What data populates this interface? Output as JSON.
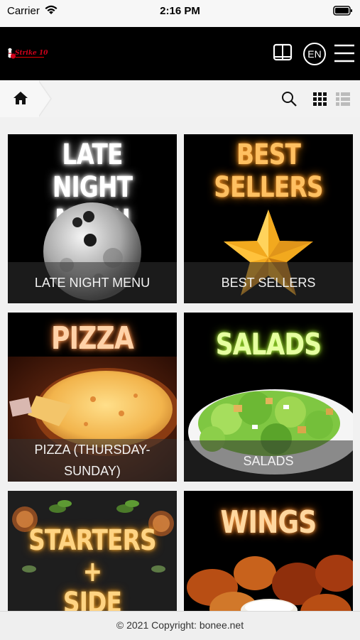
{
  "status_bar": {
    "carrier": "Carrier",
    "time": "2:16 PM"
  },
  "header": {
    "logo_text": "Strike 10",
    "language": "EN"
  },
  "toolbar": {
    "home": "home-icon",
    "search": "search-icon",
    "grid": "grid-view-icon",
    "list": "list-view-icon"
  },
  "categories": [
    {
      "title_line1": "LATE NIGHT",
      "title_line2": "MENU",
      "caption": "LATE NIGHT MENU"
    },
    {
      "title_line1": "BEST",
      "title_line2": "SELLERS",
      "caption": "BEST SELLERS"
    },
    {
      "title_line1": "PIZZA",
      "caption_line1": "PIZZA (THURSDAY-",
      "caption_line2": "SUNDAY)"
    },
    {
      "title_line1": "SALADS",
      "caption": "SALADS"
    },
    {
      "title_line1": "STARTERS",
      "title_line2": "+",
      "title_line3": "SIDE DISHES"
    },
    {
      "title_line1": "WINGS"
    }
  ],
  "footer": {
    "copyright": "© 2021 Copyright: bonee.net"
  },
  "colors": {
    "header_bg": "#000000",
    "card_bg": "#000000",
    "late_night_glow": "#ffffff",
    "best_sellers": "#ffc061",
    "pizza": "#ffd2a8",
    "salads": "#e6ffa0",
    "starters": "#ffd483",
    "wings": "#ffd79f"
  }
}
